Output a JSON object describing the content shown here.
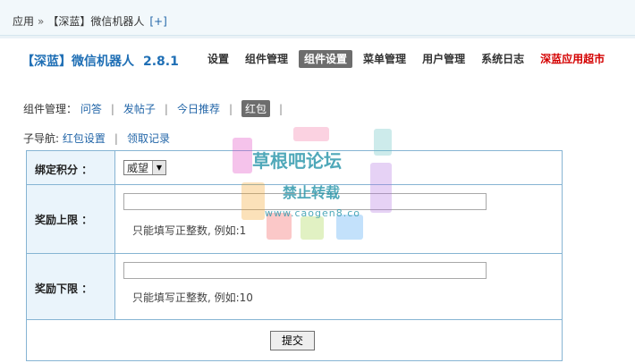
{
  "breadcrumb": {
    "root": "应用",
    "separator": "»",
    "current": "【深蓝】微信机器人",
    "add": "[+]"
  },
  "app": {
    "title": "【深蓝】微信机器人",
    "version": "2.8.1"
  },
  "nav": [
    {
      "label": "设置",
      "active": false
    },
    {
      "label": "组件管理",
      "active": false
    },
    {
      "label": "组件设置",
      "active": true
    },
    {
      "label": "菜单管理",
      "active": false
    },
    {
      "label": "用户管理",
      "active": false
    },
    {
      "label": "系统日志",
      "active": false
    },
    {
      "label": "深蓝应用超市",
      "active": false,
      "color": "#d40000"
    }
  ],
  "component_row": {
    "label": "组件管理：",
    "links": [
      "问答",
      "发帖子",
      "今日推荐"
    ],
    "active": "红包",
    "separator": "|"
  },
  "subnav_row": {
    "label": "子导航:",
    "links": [
      "红包设置",
      "领取记录"
    ],
    "separator": "|"
  },
  "form": {
    "credit": {
      "label": "绑定积分 ：",
      "selected": "威望"
    },
    "max": {
      "label": "奖励上限 ：",
      "value": "",
      "hint": "只能填写正整数, 例如:1"
    },
    "min": {
      "label": "奖励下限 ：",
      "value": "",
      "hint": "只能填写正整数, 例如:10"
    },
    "submit": "提交"
  },
  "watermark": {
    "line1": "草根吧论坛",
    "line2": "禁止转载",
    "line3": "www.caogen8.co"
  }
}
